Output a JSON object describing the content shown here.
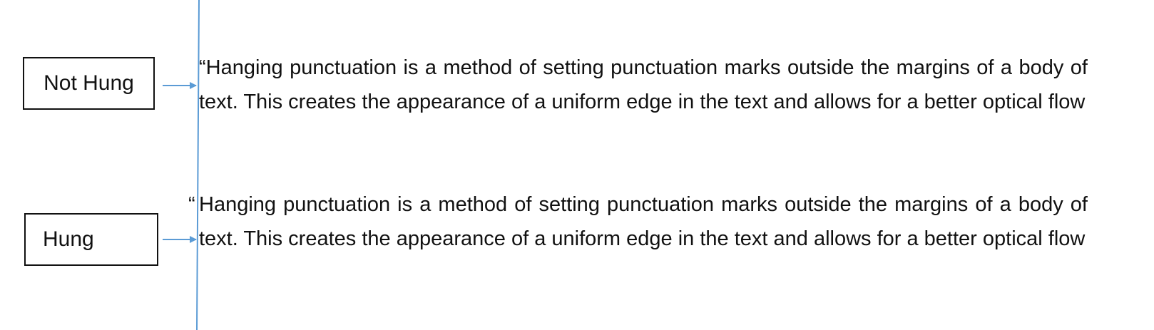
{
  "labels": {
    "not_hung": "Not Hung",
    "hung": "Hung"
  },
  "examples": {
    "not_hung": {
      "text": "“Hanging punctuation is a method of setting punctuation marks outside the margins of a body of text. This creates the appearance of a uniform edge in the text and allows for a better optical flow"
    },
    "hung": {
      "quote": "“",
      "text": "Hanging punctuation is a method of setting punctuation marks outside the margins of a body of text. This creates the appearance of a uniform edge in the text and allows for a better optical flow"
    }
  },
  "colors": {
    "guide_line": "#5B9BD5",
    "arrow": "#5B9BD5",
    "box_border": "#111111",
    "text": "#111111"
  }
}
